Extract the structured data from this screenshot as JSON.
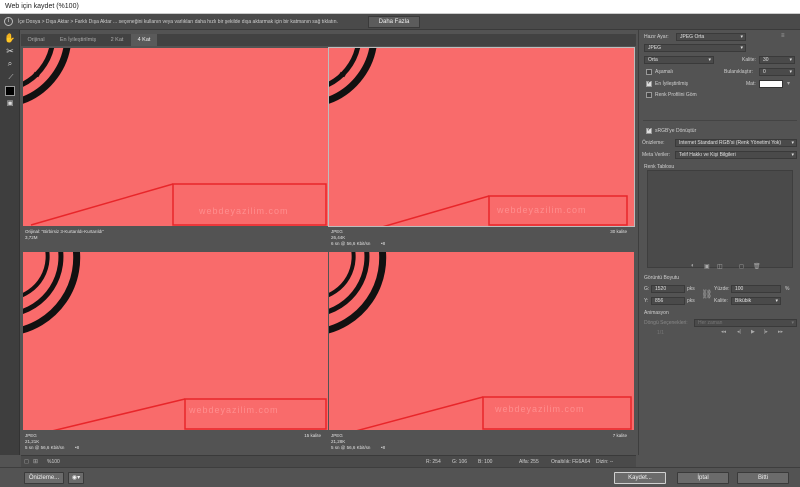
{
  "window": {
    "title": "Web için kaydet (%100)"
  },
  "infobar": {
    "message": "İçe Dosya > Dışa Aktar > Farklı Dışa Aktar ... seçeneğini kullanın veya varlıkları daha hızlı bir şekilde dışa aktarmak için bir katmanın sağ tıklatın.",
    "more_button": "Daha Fazla"
  },
  "tabs": [
    {
      "label": "Orijinal"
    },
    {
      "label": "En İyileştirilmiş"
    },
    {
      "label": "2 Kat"
    },
    {
      "label": "4 Kat"
    }
  ],
  "panes": [
    {
      "watermark": "webdeyazilim.com",
      "line1": "Orijinal: \"Birbirsiz 3-Kurtarıldı-Kurtarıldı\"",
      "line2": "3,72M",
      "right": "",
      "speed": "",
      "t8": ""
    },
    {
      "watermark": "webdeyazilim.com",
      "line1": "JPEG",
      "line2": "26,44K",
      "right": "30 kalite",
      "speed": "6 sn @ 56,6 Kbit/sn",
      "t8": "•8"
    },
    {
      "watermark": "webdeyazilim.com",
      "line1": "JPEG",
      "line2": "21,21K",
      "right": "15 kalite",
      "speed": "5 sn @ 56,6 Kbit/sn",
      "t8": "•8"
    },
    {
      "watermark": "webdeyazilim.com",
      "line1": "JPEG",
      "line2": "21,28K",
      "right": "7 kalite",
      "speed": "5 sn @ 56,6 Kbit/sn",
      "t8": "•8"
    }
  ],
  "settings": {
    "preset_label": "Hazır Ayar:",
    "preset_value": "JPEG Orta",
    "format_value": "JPEG",
    "quality_level": "Orta",
    "quality_label": "Kalite:",
    "quality_value": "30",
    "progressive": "Aşamalı",
    "blur_label": "Bulanıklaştır:",
    "blur_value": "0",
    "optimized": "En İyileştirilmiş",
    "matte_label": "Mat:",
    "embed_profile": "Renk Profilini Göm",
    "convert_srgb": "sRGB'ye Dönüştür",
    "preview_label": "Önizleme:",
    "preview_value": "Internet Standard RGB'si (Renk Yönetimi Yok)",
    "metadata_label": "Meta Veriler:",
    "metadata_value": "Telif Hakkı ve Kişi Bilgileri",
    "color_table": "Renk Tablosu",
    "image_size": "Görüntü Boyutu",
    "w_label": "G:",
    "w_value": "1520",
    "px1": "pks",
    "h_label": "Y:",
    "h_value": "856",
    "px2": "pks",
    "percent_label": "Yüzde:",
    "percent_value": "100",
    "pct": "%",
    "quality2_label": "Kalite:",
    "quality2_value": "Bikübik",
    "animation": "Animasyon",
    "loop_label": "Döngü Seçenekleri:",
    "loop_value": "Her zaman",
    "frame": "1/1"
  },
  "statusbar": {
    "zoom": "%100",
    "r": "R: 254",
    "g": "G: 106",
    "b": "B: 100",
    "alpha": "Alfa: 255",
    "hex": "Onaltılık: FE6A64",
    "index": "Dizin: --"
  },
  "buttons": {
    "preview": "Önizleme...",
    "save": "Kaydet...",
    "cancel": "İptal",
    "done": "Bitti"
  },
  "colors": {
    "image_bg": "#f96b6b",
    "annotation": "#e8262a"
  }
}
